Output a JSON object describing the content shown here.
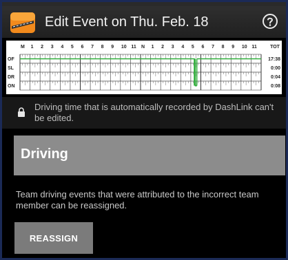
{
  "header": {
    "title": "Edit Event on Thu. Feb. 18",
    "logo_icon": "dashlink-logo-icon",
    "help_icon": "help-circle-icon"
  },
  "log_graph": {
    "hour_labels": [
      "M",
      "1",
      "2",
      "3",
      "4",
      "5",
      "6",
      "7",
      "8",
      "9",
      "10",
      "11",
      "N",
      "1",
      "2",
      "3",
      "4",
      "5",
      "6",
      "7",
      "8",
      "9",
      "10",
      "11"
    ],
    "total_header": "TOT",
    "rows": [
      {
        "status": "OF",
        "total": "17:38"
      },
      {
        "status": "SL",
        "total": "0:00"
      },
      {
        "status": "DR",
        "total": "0:04"
      },
      {
        "status": "ON",
        "total": "0:08"
      }
    ],
    "line_color": "#2fae3a"
  },
  "notice": {
    "lock_icon": "lock-icon",
    "text": "Driving time that is automatically recorded by DashLink can't be edited."
  },
  "status_field": {
    "value": "Driving"
  },
  "team_notice": {
    "text": "Team driving events that were attributed to the incorrect team member can be reassigned."
  },
  "actions": {
    "reassign_label": "REASSIGN"
  }
}
